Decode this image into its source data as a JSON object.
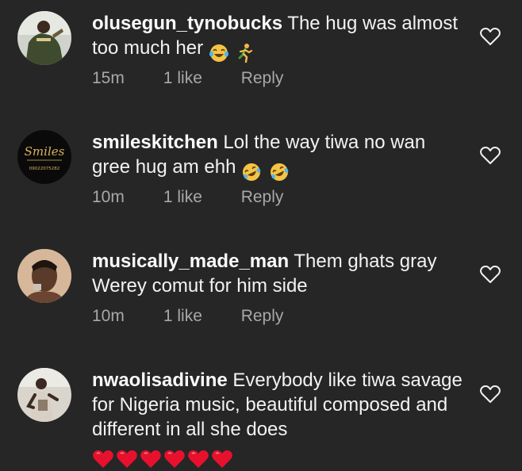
{
  "comments": [
    {
      "username": "olusegun_tynobucks",
      "text": "The hug was almost too much her",
      "emojis": [
        "laughing-tears-emoji",
        "running-person-emoji"
      ],
      "time": "15m",
      "likes": "1 like",
      "reply": "Reply"
    },
    {
      "username": "smileskitchen",
      "text": "Lol the way tiwa no wan gree hug am ehh",
      "emojis": [
        "rolling-laughing-emoji",
        "rolling-laughing-emoji"
      ],
      "time": "10m",
      "likes": "1 like",
      "reply": "Reply",
      "avatar_brand": "Smiles",
      "avatar_phone": "09022075282"
    },
    {
      "username": "musically_made_man",
      "text": "Them ghats gray Werey comut for him side",
      "emojis": [],
      "time": "10m",
      "likes": "1 like",
      "reply": "Reply"
    },
    {
      "username": "nwaolisadivine",
      "text": "Everybody like tiwa savage for Nigeria music, beautiful composed and different in all she does",
      "emojis": [
        "red-heart-emoji",
        "red-heart-emoji",
        "red-heart-emoji",
        "red-heart-emoji",
        "red-heart-emoji",
        "red-heart-emoji"
      ],
      "time": "",
      "likes": "",
      "reply": ""
    }
  ],
  "colors": {
    "background": "#262626",
    "primary_text": "#f5f5f5",
    "secondary_text": "#a8a8a8",
    "heart_emoji": "#e8112d"
  }
}
